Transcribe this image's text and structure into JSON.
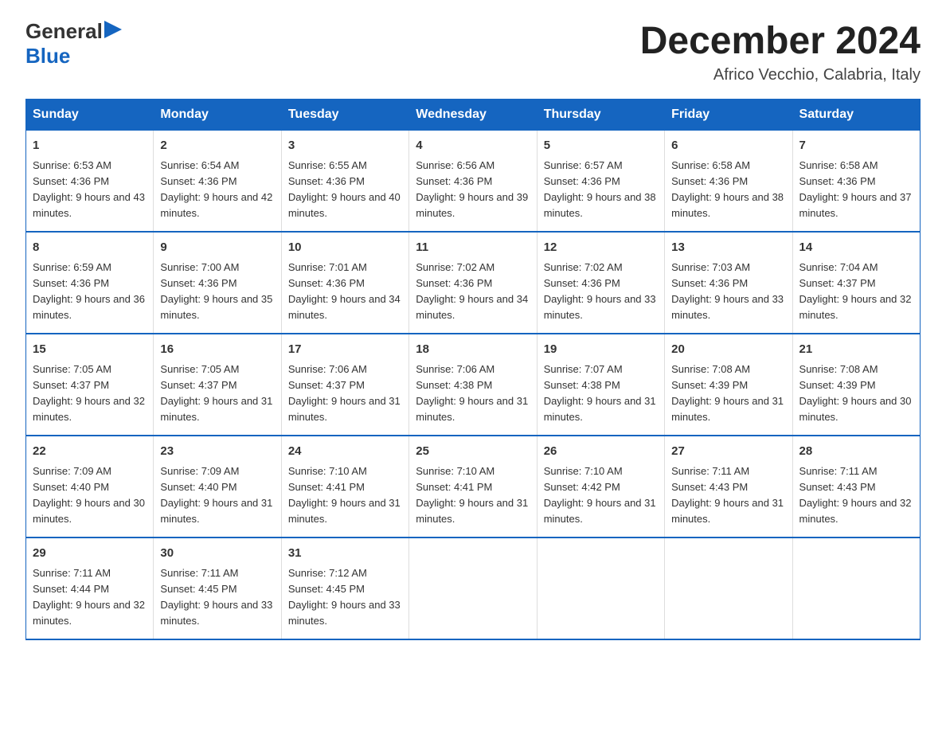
{
  "logo": {
    "general": "General",
    "arrow": "▶",
    "blue": "Blue"
  },
  "header": {
    "month_year": "December 2024",
    "location": "Africo Vecchio, Calabria, Italy"
  },
  "days_of_week": [
    "Sunday",
    "Monday",
    "Tuesday",
    "Wednesday",
    "Thursday",
    "Friday",
    "Saturday"
  ],
  "weeks": [
    [
      {
        "day": "1",
        "sunrise": "6:53 AM",
        "sunset": "4:36 PM",
        "daylight": "9 hours and 43 minutes."
      },
      {
        "day": "2",
        "sunrise": "6:54 AM",
        "sunset": "4:36 PM",
        "daylight": "9 hours and 42 minutes."
      },
      {
        "day": "3",
        "sunrise": "6:55 AM",
        "sunset": "4:36 PM",
        "daylight": "9 hours and 40 minutes."
      },
      {
        "day": "4",
        "sunrise": "6:56 AM",
        "sunset": "4:36 PM",
        "daylight": "9 hours and 39 minutes."
      },
      {
        "day": "5",
        "sunrise": "6:57 AM",
        "sunset": "4:36 PM",
        "daylight": "9 hours and 38 minutes."
      },
      {
        "day": "6",
        "sunrise": "6:58 AM",
        "sunset": "4:36 PM",
        "daylight": "9 hours and 38 minutes."
      },
      {
        "day": "7",
        "sunrise": "6:58 AM",
        "sunset": "4:36 PM",
        "daylight": "9 hours and 37 minutes."
      }
    ],
    [
      {
        "day": "8",
        "sunrise": "6:59 AM",
        "sunset": "4:36 PM",
        "daylight": "9 hours and 36 minutes."
      },
      {
        "day": "9",
        "sunrise": "7:00 AM",
        "sunset": "4:36 PM",
        "daylight": "9 hours and 35 minutes."
      },
      {
        "day": "10",
        "sunrise": "7:01 AM",
        "sunset": "4:36 PM",
        "daylight": "9 hours and 34 minutes."
      },
      {
        "day": "11",
        "sunrise": "7:02 AM",
        "sunset": "4:36 PM",
        "daylight": "9 hours and 34 minutes."
      },
      {
        "day": "12",
        "sunrise": "7:02 AM",
        "sunset": "4:36 PM",
        "daylight": "9 hours and 33 minutes."
      },
      {
        "day": "13",
        "sunrise": "7:03 AM",
        "sunset": "4:36 PM",
        "daylight": "9 hours and 33 minutes."
      },
      {
        "day": "14",
        "sunrise": "7:04 AM",
        "sunset": "4:37 PM",
        "daylight": "9 hours and 32 minutes."
      }
    ],
    [
      {
        "day": "15",
        "sunrise": "7:05 AM",
        "sunset": "4:37 PM",
        "daylight": "9 hours and 32 minutes."
      },
      {
        "day": "16",
        "sunrise": "7:05 AM",
        "sunset": "4:37 PM",
        "daylight": "9 hours and 31 minutes."
      },
      {
        "day": "17",
        "sunrise": "7:06 AM",
        "sunset": "4:37 PM",
        "daylight": "9 hours and 31 minutes."
      },
      {
        "day": "18",
        "sunrise": "7:06 AM",
        "sunset": "4:38 PM",
        "daylight": "9 hours and 31 minutes."
      },
      {
        "day": "19",
        "sunrise": "7:07 AM",
        "sunset": "4:38 PM",
        "daylight": "9 hours and 31 minutes."
      },
      {
        "day": "20",
        "sunrise": "7:08 AM",
        "sunset": "4:39 PM",
        "daylight": "9 hours and 31 minutes."
      },
      {
        "day": "21",
        "sunrise": "7:08 AM",
        "sunset": "4:39 PM",
        "daylight": "9 hours and 30 minutes."
      }
    ],
    [
      {
        "day": "22",
        "sunrise": "7:09 AM",
        "sunset": "4:40 PM",
        "daylight": "9 hours and 30 minutes."
      },
      {
        "day": "23",
        "sunrise": "7:09 AM",
        "sunset": "4:40 PM",
        "daylight": "9 hours and 31 minutes."
      },
      {
        "day": "24",
        "sunrise": "7:10 AM",
        "sunset": "4:41 PM",
        "daylight": "9 hours and 31 minutes."
      },
      {
        "day": "25",
        "sunrise": "7:10 AM",
        "sunset": "4:41 PM",
        "daylight": "9 hours and 31 minutes."
      },
      {
        "day": "26",
        "sunrise": "7:10 AM",
        "sunset": "4:42 PM",
        "daylight": "9 hours and 31 minutes."
      },
      {
        "day": "27",
        "sunrise": "7:11 AM",
        "sunset": "4:43 PM",
        "daylight": "9 hours and 31 minutes."
      },
      {
        "day": "28",
        "sunrise": "7:11 AM",
        "sunset": "4:43 PM",
        "daylight": "9 hours and 32 minutes."
      }
    ],
    [
      {
        "day": "29",
        "sunrise": "7:11 AM",
        "sunset": "4:44 PM",
        "daylight": "9 hours and 32 minutes."
      },
      {
        "day": "30",
        "sunrise": "7:11 AM",
        "sunset": "4:45 PM",
        "daylight": "9 hours and 33 minutes."
      },
      {
        "day": "31",
        "sunrise": "7:12 AM",
        "sunset": "4:45 PM",
        "daylight": "9 hours and 33 minutes."
      },
      null,
      null,
      null,
      null
    ]
  ],
  "labels": {
    "sunrise": "Sunrise: ",
    "sunset": "Sunset: ",
    "daylight": "Daylight: "
  }
}
